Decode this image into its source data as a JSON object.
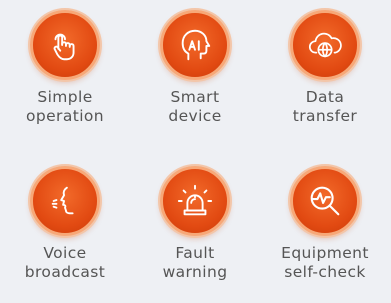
{
  "accent_color": "#e24a12",
  "ring_color": "#f7a878",
  "label_color": "#555555",
  "features": [
    {
      "icon": "hand-tap-icon",
      "line1": "Simple",
      "line2": "operation"
    },
    {
      "icon": "ai-head-icon",
      "line1": "Smart",
      "line2": "device"
    },
    {
      "icon": "cloud-globe-icon",
      "line1": "Data",
      "line2": "transfer"
    },
    {
      "icon": "voice-speaking-icon",
      "line1": "Voice",
      "line2": "broadcast"
    },
    {
      "icon": "alarm-light-icon",
      "line1": "Fault",
      "line2": "warning"
    },
    {
      "icon": "magnifier-pulse-icon",
      "line1": "Equipment",
      "line2": "self-check"
    }
  ]
}
